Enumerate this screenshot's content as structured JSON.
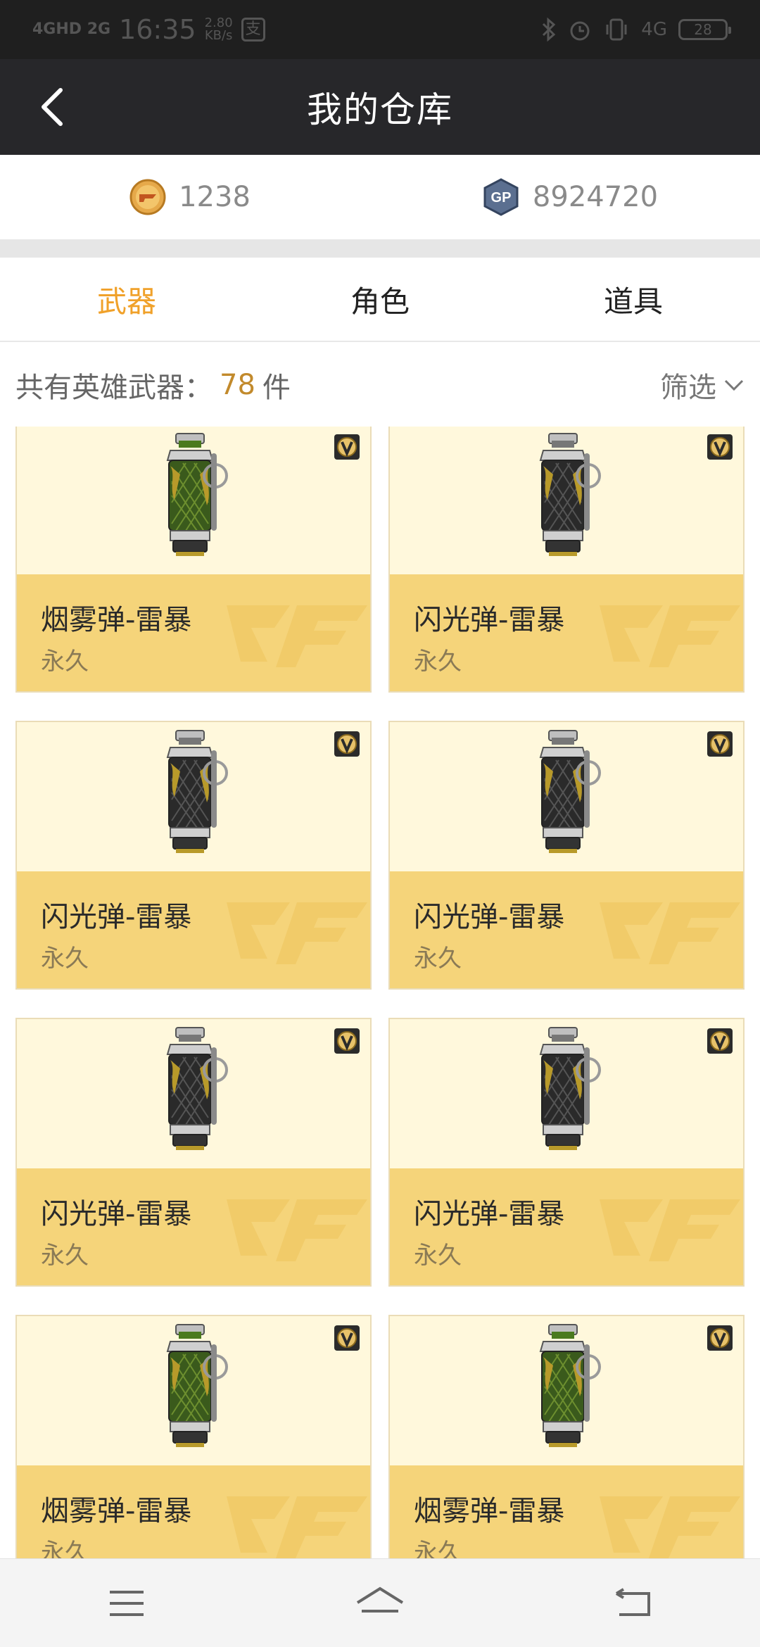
{
  "status_bar": {
    "network": "4GHD 2G",
    "time": "16:35",
    "speed_value": "2.80",
    "speed_unit": "KB/s",
    "pay_icon_label": "支",
    "net_right": "4G",
    "battery": "28",
    "icons": [
      "bluetooth-icon",
      "alarm-icon",
      "vibrate-icon"
    ]
  },
  "header": {
    "title": "我的仓库",
    "back_icon": "chevron-left-icon"
  },
  "currency": {
    "coins": "1238",
    "gp_label": "GP",
    "gp": "8924720"
  },
  "tabs": [
    {
      "label": "武器",
      "active": true
    },
    {
      "label": "角色",
      "active": false
    },
    {
      "label": "道具",
      "active": false
    }
  ],
  "summary": {
    "label": "共有英雄武器：",
    "count": "78",
    "unit": "件",
    "filter": "筛选"
  },
  "items": [
    {
      "name": "烟雾弹-雷暴",
      "duration": "永久",
      "variant": "green"
    },
    {
      "name": "闪光弹-雷暴",
      "duration": "永久",
      "variant": "dark"
    },
    {
      "name": "闪光弹-雷暴",
      "duration": "永久",
      "variant": "dark"
    },
    {
      "name": "闪光弹-雷暴",
      "duration": "永久",
      "variant": "dark"
    },
    {
      "name": "闪光弹-雷暴",
      "duration": "永久",
      "variant": "dark"
    },
    {
      "name": "闪光弹-雷暴",
      "duration": "永久",
      "variant": "dark"
    },
    {
      "name": "烟雾弹-雷暴",
      "duration": "永久",
      "variant": "green"
    },
    {
      "name": "烟雾弹-雷暴",
      "duration": "永久",
      "variant": "green"
    }
  ],
  "colors": {
    "accent": "#f0a12a",
    "card_bg": "#fff8dc",
    "card_info": "#f5d47a"
  },
  "nav_bar": [
    "menu-icon",
    "home-icon",
    "back-icon"
  ]
}
